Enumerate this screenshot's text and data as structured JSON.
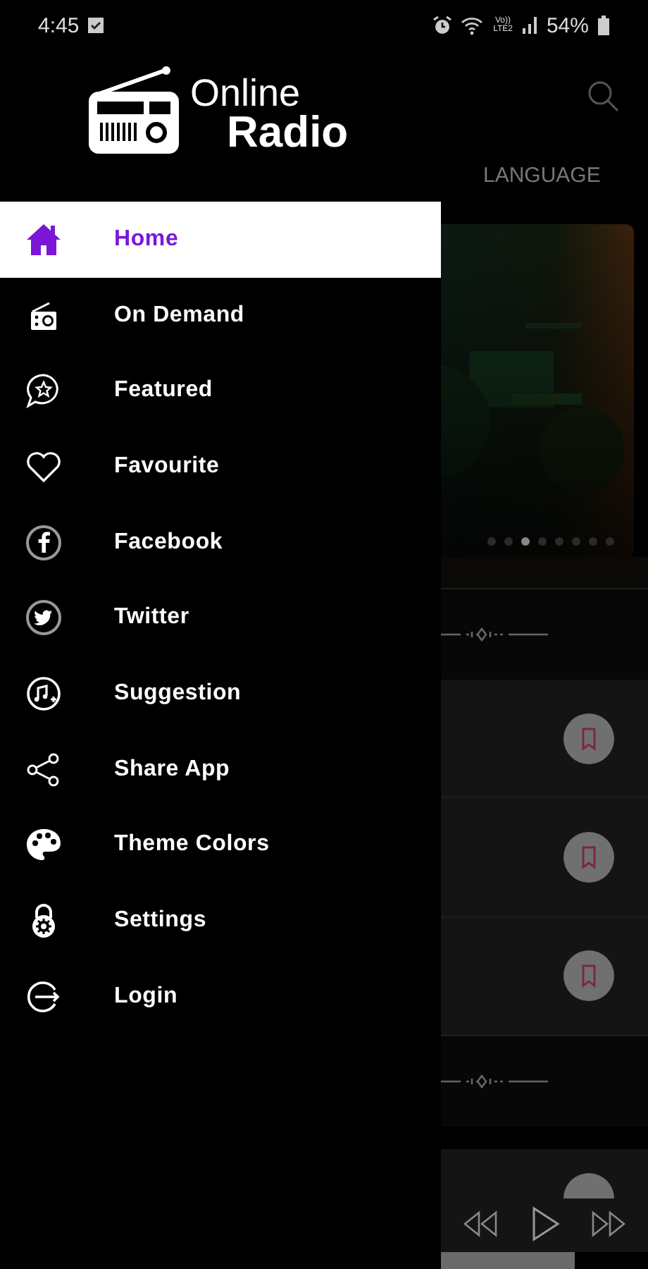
{
  "status_bar": {
    "time": "4:45",
    "volte": "Vo))",
    "network": "LTE2",
    "battery": "54%"
  },
  "drawer": {
    "logo": {
      "line_1": "Online",
      "line_2": "Radio"
    },
    "items": [
      {
        "label": "Home",
        "kind": "home",
        "selected": true
      },
      {
        "label": "On Demand",
        "kind": "radio",
        "selected": false
      },
      {
        "label": "Featured",
        "kind": "featured",
        "selected": false
      },
      {
        "label": "Favourite",
        "kind": "heart",
        "selected": false
      },
      {
        "label": "Facebook",
        "kind": "facebook",
        "selected": false
      },
      {
        "label": "Twitter",
        "kind": "twitter",
        "selected": false
      },
      {
        "label": "Suggestion",
        "kind": "suggestion",
        "selected": false
      },
      {
        "label": "Share App",
        "kind": "share",
        "selected": false
      },
      {
        "label": "Theme Colors",
        "kind": "palette",
        "selected": false
      },
      {
        "label": "Settings",
        "kind": "settings",
        "selected": false
      },
      {
        "label": "Login",
        "kind": "login",
        "selected": false
      }
    ]
  },
  "background_screen": {
    "tab": "LANGUAGE",
    "carousel_dots": [
      {
        "selected": false
      },
      {
        "selected": false
      },
      {
        "selected": true
      },
      {
        "selected": false
      },
      {
        "selected": false
      },
      {
        "selected": false
      },
      {
        "selected": false
      },
      {
        "selected": false
      }
    ],
    "sections": [
      {
        "kind": "wave"
      },
      {
        "kind": "station"
      },
      {
        "kind": "station"
      },
      {
        "kind": "station"
      },
      {
        "kind": "wave"
      },
      {
        "kind": "station_cut"
      }
    ]
  }
}
